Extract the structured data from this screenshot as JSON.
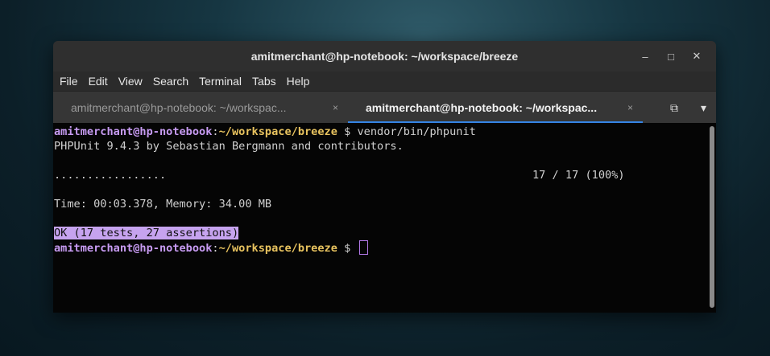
{
  "window": {
    "title": "amitmerchant@hp-notebook: ~/workspace/breeze",
    "controls": {
      "minimize": "–",
      "maximize": "□",
      "close": "✕"
    }
  },
  "menu": [
    "File",
    "Edit",
    "View",
    "Search",
    "Terminal",
    "Tabs",
    "Help"
  ],
  "tabs": [
    {
      "label": "amitmerchant@hp-notebook: ~/workspac...",
      "close": "×",
      "active": false
    },
    {
      "label": "amitmerchant@hp-notebook: ~/workspac...",
      "close": "×",
      "active": true
    }
  ],
  "tab_actions": {
    "new_tab_icon": "⧉",
    "menu_icon": "▾"
  },
  "terminal": {
    "prompt_user": "amitmerchant@hp-notebook",
    "prompt_path": "~/workspace/breeze",
    "prompt_symbol": "$",
    "command": "vendor/bin/phpunit",
    "line2": "PHPUnit 9.4.3 by Sebastian Bergmann and contributors.",
    "progress_dots": ".................",
    "progress_count": "17 / 17 (100%)",
    "time_line": "Time: 00:03.378, Memory: 34.00 MB",
    "result": "OK (17 tests, 27 assertions)"
  },
  "colors": {
    "accent": "#3584e4",
    "prompt_user": "#c79bf2",
    "prompt_path": "#e8c35f",
    "highlight": "#c6a3ef"
  }
}
